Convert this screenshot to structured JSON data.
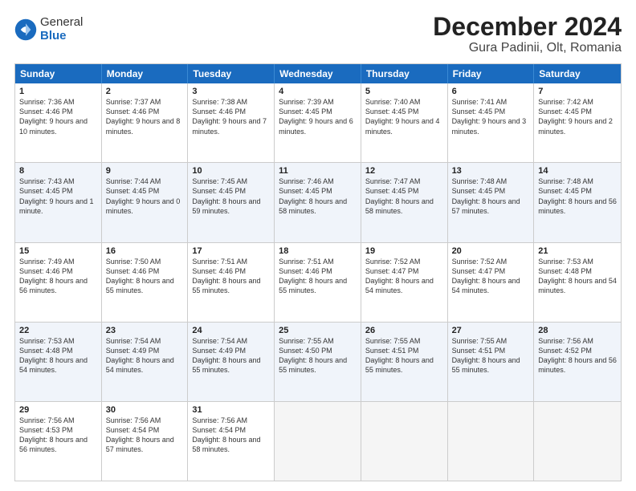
{
  "logo": {
    "general": "General",
    "blue": "Blue"
  },
  "title": "December 2024",
  "subtitle": "Gura Padinii, Olt, Romania",
  "days_of_week": [
    "Sunday",
    "Monday",
    "Tuesday",
    "Wednesday",
    "Thursday",
    "Friday",
    "Saturday"
  ],
  "weeks": [
    [
      {
        "day": 1,
        "sunrise": "7:36 AM",
        "sunset": "4:46 PM",
        "daylight": "9 hours and 10 minutes."
      },
      {
        "day": 2,
        "sunrise": "7:37 AM",
        "sunset": "4:46 PM",
        "daylight": "9 hours and 8 minutes."
      },
      {
        "day": 3,
        "sunrise": "7:38 AM",
        "sunset": "4:46 PM",
        "daylight": "9 hours and 7 minutes."
      },
      {
        "day": 4,
        "sunrise": "7:39 AM",
        "sunset": "4:45 PM",
        "daylight": "9 hours and 6 minutes."
      },
      {
        "day": 5,
        "sunrise": "7:40 AM",
        "sunset": "4:45 PM",
        "daylight": "9 hours and 4 minutes."
      },
      {
        "day": 6,
        "sunrise": "7:41 AM",
        "sunset": "4:45 PM",
        "daylight": "9 hours and 3 minutes."
      },
      {
        "day": 7,
        "sunrise": "7:42 AM",
        "sunset": "4:45 PM",
        "daylight": "9 hours and 2 minutes."
      }
    ],
    [
      {
        "day": 8,
        "sunrise": "7:43 AM",
        "sunset": "4:45 PM",
        "daylight": "9 hours and 1 minute."
      },
      {
        "day": 9,
        "sunrise": "7:44 AM",
        "sunset": "4:45 PM",
        "daylight": "9 hours and 0 minutes."
      },
      {
        "day": 10,
        "sunrise": "7:45 AM",
        "sunset": "4:45 PM",
        "daylight": "8 hours and 59 minutes."
      },
      {
        "day": 11,
        "sunrise": "7:46 AM",
        "sunset": "4:45 PM",
        "daylight": "8 hours and 58 minutes."
      },
      {
        "day": 12,
        "sunrise": "7:47 AM",
        "sunset": "4:45 PM",
        "daylight": "8 hours and 58 minutes."
      },
      {
        "day": 13,
        "sunrise": "7:48 AM",
        "sunset": "4:45 PM",
        "daylight": "8 hours and 57 minutes."
      },
      {
        "day": 14,
        "sunrise": "7:48 AM",
        "sunset": "4:45 PM",
        "daylight": "8 hours and 56 minutes."
      }
    ],
    [
      {
        "day": 15,
        "sunrise": "7:49 AM",
        "sunset": "4:46 PM",
        "daylight": "8 hours and 56 minutes."
      },
      {
        "day": 16,
        "sunrise": "7:50 AM",
        "sunset": "4:46 PM",
        "daylight": "8 hours and 55 minutes."
      },
      {
        "day": 17,
        "sunrise": "7:51 AM",
        "sunset": "4:46 PM",
        "daylight": "8 hours and 55 minutes."
      },
      {
        "day": 18,
        "sunrise": "7:51 AM",
        "sunset": "4:46 PM",
        "daylight": "8 hours and 55 minutes."
      },
      {
        "day": 19,
        "sunrise": "7:52 AM",
        "sunset": "4:47 PM",
        "daylight": "8 hours and 54 minutes."
      },
      {
        "day": 20,
        "sunrise": "7:52 AM",
        "sunset": "4:47 PM",
        "daylight": "8 hours and 54 minutes."
      },
      {
        "day": 21,
        "sunrise": "7:53 AM",
        "sunset": "4:48 PM",
        "daylight": "8 hours and 54 minutes."
      }
    ],
    [
      {
        "day": 22,
        "sunrise": "7:53 AM",
        "sunset": "4:48 PM",
        "daylight": "8 hours and 54 minutes."
      },
      {
        "day": 23,
        "sunrise": "7:54 AM",
        "sunset": "4:49 PM",
        "daylight": "8 hours and 54 minutes."
      },
      {
        "day": 24,
        "sunrise": "7:54 AM",
        "sunset": "4:49 PM",
        "daylight": "8 hours and 55 minutes."
      },
      {
        "day": 25,
        "sunrise": "7:55 AM",
        "sunset": "4:50 PM",
        "daylight": "8 hours and 55 minutes."
      },
      {
        "day": 26,
        "sunrise": "7:55 AM",
        "sunset": "4:51 PM",
        "daylight": "8 hours and 55 minutes."
      },
      {
        "day": 27,
        "sunrise": "7:55 AM",
        "sunset": "4:51 PM",
        "daylight": "8 hours and 55 minutes."
      },
      {
        "day": 28,
        "sunrise": "7:56 AM",
        "sunset": "4:52 PM",
        "daylight": "8 hours and 56 minutes."
      }
    ],
    [
      {
        "day": 29,
        "sunrise": "7:56 AM",
        "sunset": "4:53 PM",
        "daylight": "8 hours and 56 minutes."
      },
      {
        "day": 30,
        "sunrise": "7:56 AM",
        "sunset": "4:54 PM",
        "daylight": "8 hours and 57 minutes."
      },
      {
        "day": 31,
        "sunrise": "7:56 AM",
        "sunset": "4:54 PM",
        "daylight": "8 hours and 58 minutes."
      },
      null,
      null,
      null,
      null
    ]
  ]
}
